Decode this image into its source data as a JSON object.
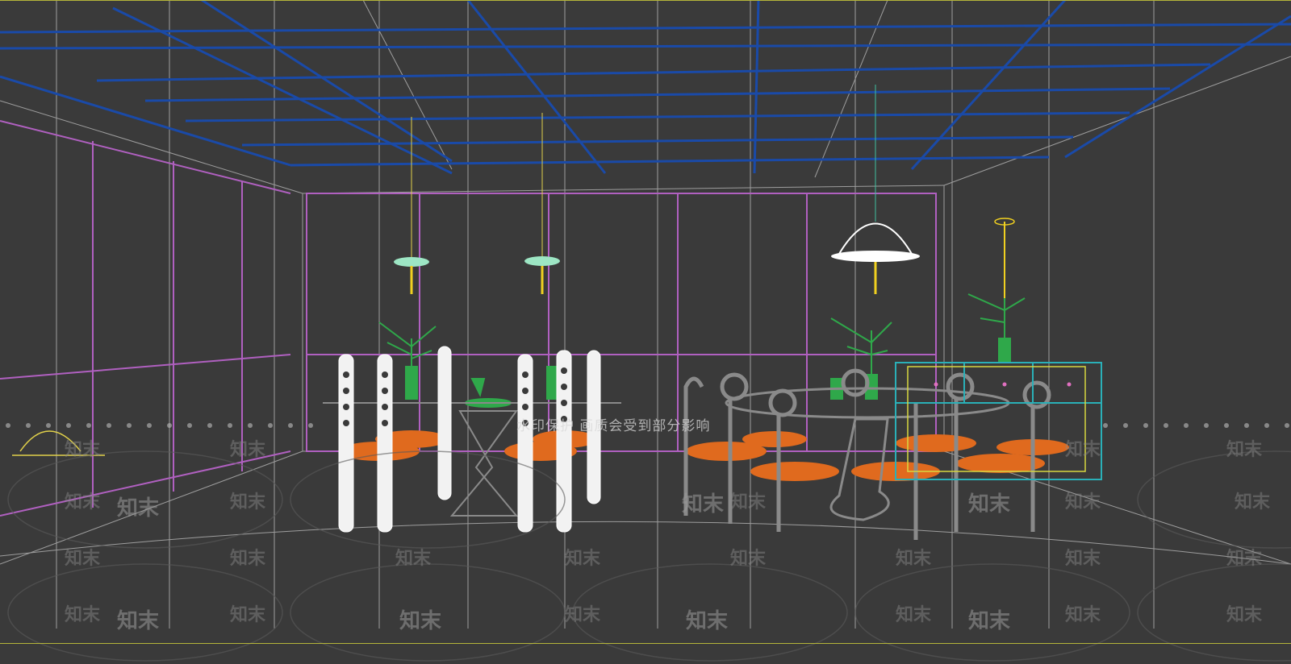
{
  "viewport": {
    "watermark_notice": "水印保护 画质会受到部分影响",
    "brand_watermark": "知末"
  },
  "colors": {
    "background": "#3a3a3a",
    "ceiling": "#1a4aa8",
    "walls": "#b060c0",
    "chairs": "#f2f2f2",
    "cushions": "#e06a1e",
    "plants": "#2fa84a",
    "cabinet": "#2ab0b8",
    "frame": "#b5b53a"
  }
}
